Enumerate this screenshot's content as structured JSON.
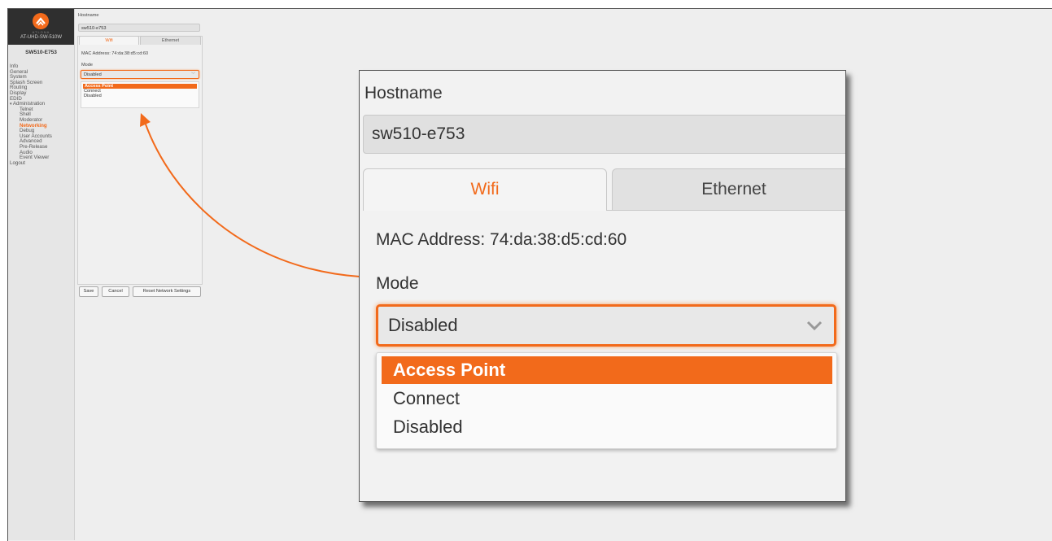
{
  "sidebar": {
    "brand": "ATLONA",
    "model": "AT-UHD-SW-510W",
    "device_name": "SW510-E753",
    "items": [
      {
        "label": "Info",
        "level": 1
      },
      {
        "label": "General",
        "level": 1
      },
      {
        "label": "System",
        "level": 1
      },
      {
        "label": "Splash Screen",
        "level": 1
      },
      {
        "label": "Routing",
        "level": 1
      },
      {
        "label": "Display",
        "level": 1
      },
      {
        "label": "EDID",
        "level": 1
      },
      {
        "label": "Administration",
        "level": 1,
        "expanded": true
      },
      {
        "label": "Telnet",
        "level": 2
      },
      {
        "label": "Shell",
        "level": 2
      },
      {
        "label": "Moderator",
        "level": 2
      },
      {
        "label": "Networking",
        "level": 2,
        "active": true
      },
      {
        "label": "Debug",
        "level": 2
      },
      {
        "label": "User Accounts",
        "level": 2
      },
      {
        "label": "Advanced",
        "level": 2
      },
      {
        "label": "Pre-Release",
        "level": 2
      },
      {
        "label": "Audio",
        "level": 2
      },
      {
        "label": "Event Viewer",
        "level": 2
      },
      {
        "label": "Logout",
        "level": 1
      }
    ]
  },
  "form": {
    "hostname_label": "Hostname",
    "hostname_value": "sw510-e753",
    "tabs": [
      "Wifi",
      "Ethernet"
    ],
    "active_tab": "Wifi",
    "mac_label": "MAC Address: 74:da:38:d5:cd:60",
    "mode_label": "Mode",
    "mode_value": "Disabled",
    "mode_options": [
      "Access Point",
      "Connect",
      "Disabled"
    ],
    "highlighted_option": "Access Point"
  },
  "buttons": {
    "save": "Save",
    "cancel": "Cancel",
    "reset": "Reset Network Settings"
  },
  "colors": {
    "accent": "#f26a1b",
    "sidebar_bg": "#e6e6e6",
    "logo_bg": "#2f2f2f"
  }
}
